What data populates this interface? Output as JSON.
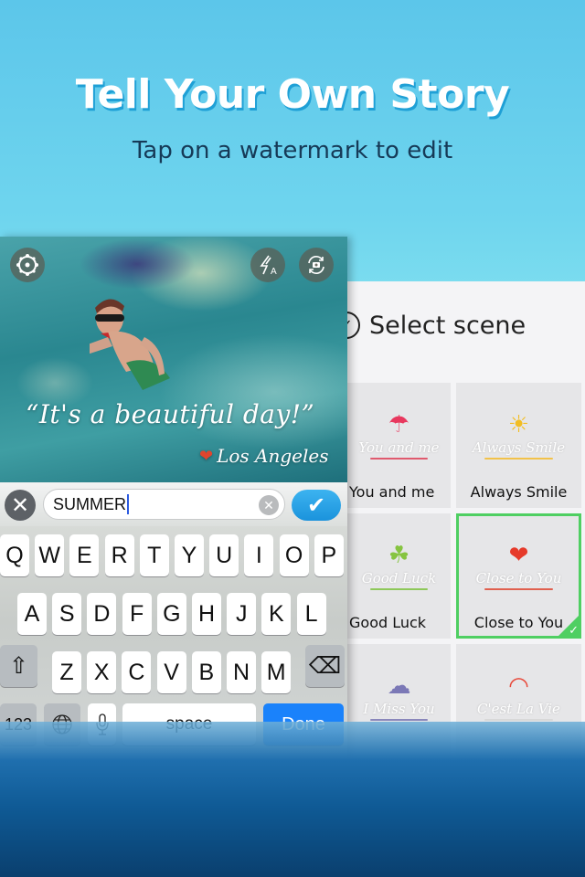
{
  "promo": {
    "headline": "Tell Your Own Story",
    "subheadline": "Tap on a watermark to edit"
  },
  "camera": {
    "settings_icon": "settings-gear-icon",
    "flash_icon": "flash-auto-icon",
    "flash_label": "A",
    "switch_icon": "switch-camera-icon",
    "watermark_quote": "“It's a beautiful day!”",
    "watermark_location": "Los Angeles",
    "location_icon": "heart-icon"
  },
  "editor": {
    "cancel_icon": "close-icon",
    "input_value": "SUMMER",
    "clear_icon": "clear-icon",
    "confirm_icon": "checkmark-icon"
  },
  "keyboard": {
    "row1": [
      "Q",
      "W",
      "E",
      "R",
      "T",
      "Y",
      "U",
      "I",
      "O",
      "P"
    ],
    "row2": [
      "A",
      "S",
      "D",
      "F",
      "G",
      "H",
      "J",
      "K",
      "L"
    ],
    "row3": [
      "Z",
      "X",
      "C",
      "V",
      "B",
      "N",
      "M"
    ],
    "shift_icon": "⇧",
    "delete_icon": "⌫",
    "numbers_label": "123",
    "globe_icon": "🌐",
    "mic_icon": "🎙",
    "space_label": "space",
    "done_label": "Done",
    "done_color": "#1a82fb"
  },
  "scene_panel": {
    "title": "Select scene",
    "back_icon": "back-check-icon",
    "selected_color": "#4fcf62",
    "scenes": [
      {
        "label": "You and me",
        "script": "You and me",
        "glyph": "☂",
        "glyph_color": "#e8385e",
        "line_color": "#e05a6e",
        "selected": false
      },
      {
        "label": "Always Smile",
        "script": "Always Smile",
        "glyph": "☀",
        "glyph_color": "#f2bd22",
        "line_color": "#f2c24a",
        "selected": false
      },
      {
        "label": "Good Luck",
        "script": "Good Luck",
        "glyph": "☘",
        "glyph_color": "#86c440",
        "line_color": "#8ec85a",
        "selected": false
      },
      {
        "label": "Close to You",
        "script": "Close to You",
        "glyph": "❤",
        "glyph_color": "#e63a2a",
        "line_color": "#e0604f",
        "selected": true
      },
      {
        "label": "",
        "script": "I Miss You",
        "glyph": "☁",
        "glyph_color": "#7b78b6",
        "line_color": "#8a87bb",
        "selected": false
      },
      {
        "label": "",
        "script": "C'est La Vie",
        "glyph": "◠",
        "glyph_color": "#e84a3b",
        "line_color": "#d8d8d8",
        "selected": false
      }
    ]
  }
}
